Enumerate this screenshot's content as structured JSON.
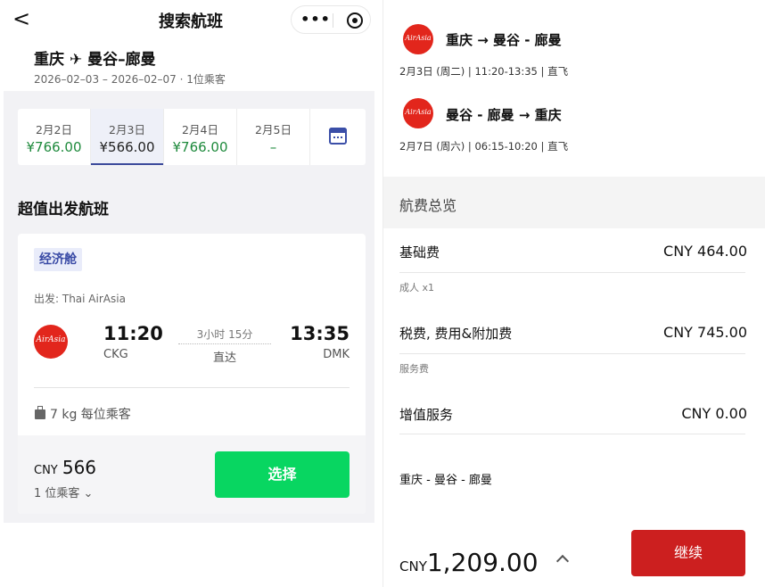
{
  "nav": {
    "back_glyph": "<",
    "title": "搜索航班",
    "more_glyph": "•••"
  },
  "route": {
    "title": "重庆 ✈ 曼谷–廊曼",
    "subtitle": "2026–02–03 – 2026–02–07 · 1位乘客"
  },
  "dates": [
    {
      "date": "2月2日",
      "price": "¥766.00",
      "selected": false
    },
    {
      "date": "2月3日",
      "price": "¥566.00",
      "selected": true
    },
    {
      "date": "2月4日",
      "price": "¥766.00",
      "selected": false
    },
    {
      "date": "2月5日",
      "price": "–",
      "selected": false
    }
  ],
  "calendar_icon": "calendar-icon",
  "section_title": "超值出发航班",
  "flight": {
    "cabin": "经济舱",
    "depart_from": "出发: Thai AirAsia",
    "airline_logo_text": "AirAsia",
    "dep_time": "11:20",
    "dep_code": "CKG",
    "duration": "3小时 15分",
    "stops": "直达",
    "arr_time": "13:35",
    "arr_code": "DMK",
    "baggage": "7 kg  每位乘客",
    "currency": "CNY",
    "price": "566",
    "passengers": "1 位乘客 ⌄",
    "select_label": "选择"
  },
  "summary": {
    "segments": [
      {
        "route": "重庆 → 曼谷 - 廊曼",
        "detail": "2月3日 (周二) | 11:20-13:35 | 直飞",
        "logo_text": "AirAsia"
      },
      {
        "route": "曼谷 - 廊曼 → 重庆",
        "detail": "2月7日 (周六) | 06:15-10:20 | 直飞",
        "logo_text": "AirAsia"
      }
    ],
    "fare_title": "航费总览",
    "fees": [
      {
        "label": "基础费",
        "value": "CNY  464.00",
        "sub": "成人 x1"
      },
      {
        "label": "税费, 费用&附加费",
        "value": "CNY  745.00",
        "sub": "服务费"
      },
      {
        "label": "增值服务",
        "value": "CNY  0.00",
        "sub": ""
      }
    ],
    "footer_route": "重庆 - 曼谷 - 廊曼",
    "total_currency": "CNY",
    "total_value": "1,209.00",
    "continue_label": "继续"
  },
  "colors": {
    "green": "#08d661",
    "red": "#cc1f1f",
    "accent": "#3b4a9b",
    "price_green": "#1e8a3c",
    "airasia_red": "#e2261c"
  }
}
